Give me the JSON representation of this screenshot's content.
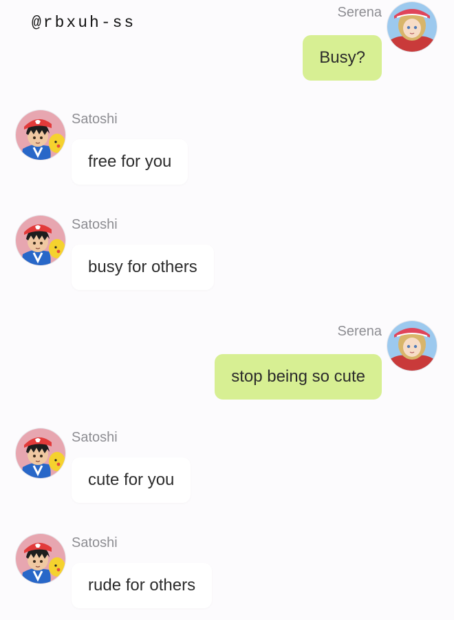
{
  "watermark": "@rbxuh-ss",
  "colors": {
    "background": "#fcfbfd",
    "incoming_bubble": "#ffffff",
    "outgoing_bubble": "#d7ef93",
    "sender_name": "#8d8d92"
  },
  "messages": [
    {
      "sender": "Serena",
      "text": "Busy?",
      "direction": "outgoing",
      "avatar_icon": "serena-avatar-icon"
    },
    {
      "sender": "Satoshi",
      "text": "free for you",
      "direction": "incoming",
      "avatar_icon": "satoshi-avatar-icon"
    },
    {
      "sender": "Satoshi",
      "text": "busy for others",
      "direction": "incoming",
      "avatar_icon": "satoshi-avatar-icon"
    },
    {
      "sender": "Serena",
      "text": "stop being so cute",
      "direction": "outgoing",
      "avatar_icon": "serena-avatar-icon"
    },
    {
      "sender": "Satoshi",
      "text": "cute for you",
      "direction": "incoming",
      "avatar_icon": "satoshi-avatar-icon"
    },
    {
      "sender": "Satoshi",
      "text": "rude for others",
      "direction": "incoming",
      "avatar_icon": "satoshi-avatar-icon"
    }
  ]
}
